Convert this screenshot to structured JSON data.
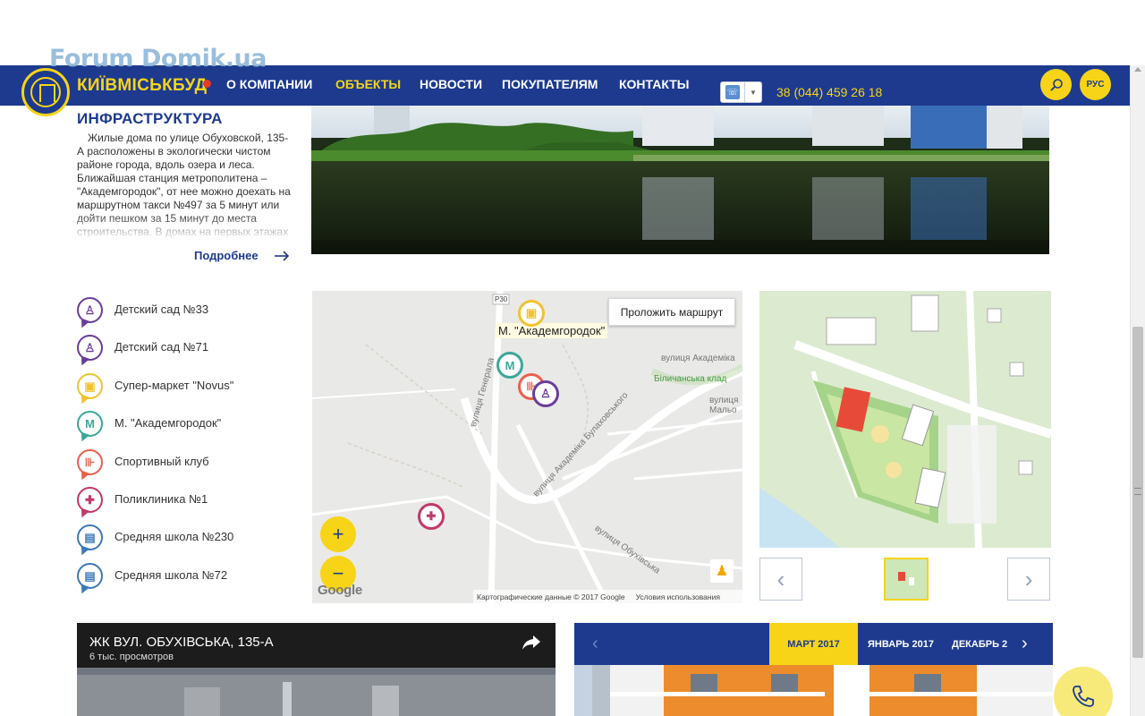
{
  "watermark": "Forum Domik.ua",
  "header": {
    "logo_text": "КИЇВМІСЬКБУД",
    "nav": [
      "О КОМПАНИИ",
      "ОБЪЕКТЫ",
      "НОВОСТИ",
      "ПОКУПАТЕЛЯМ",
      "КОНТАКТЫ"
    ],
    "active_nav": "ОБЪЕКТЫ",
    "phone": "38 (044) 459 26 18",
    "lang": "РУС",
    "search_icon": "search-icon"
  },
  "infrastructure": {
    "title": "ИНФРАСТРУКТУРА",
    "text": "Жилые дома по улице Обуховской, 135-А расположены в экологически чистом районе города, вдоль озера и леса. Ближайшая станция метрополитена – \"Академгородок\", от нее можно доехать на маршрутном такси №497 за 5 минут или дойти пешком за 15 минут до места строительства. В домах на первых этажах",
    "more": "Подробнее"
  },
  "legend": [
    {
      "label": "Детский сад №33",
      "icon": "kids-icon",
      "color": "#6a3d9a"
    },
    {
      "label": "Детский сад №71",
      "icon": "kids-icon",
      "color": "#6a3d9a"
    },
    {
      "label": "Супер-маркет \"Novus\"",
      "icon": "shopping-bag-icon",
      "color": "#f2c230"
    },
    {
      "label": "М. \"Академгородок\"",
      "icon": "metro-icon",
      "color": "#3aa89a"
    },
    {
      "label": "Спортивный клуб",
      "icon": "dumbbell-icon",
      "color": "#e8604c"
    },
    {
      "label": "Поликлиника №1",
      "icon": "medical-icon",
      "color": "#c2386a"
    },
    {
      "label": "Средняя школа №230",
      "icon": "book-icon",
      "color": "#3d79b8"
    },
    {
      "label": "Средняя школа №72",
      "icon": "book-icon",
      "color": "#3d79b8"
    }
  ],
  "map": {
    "route_button": "Проложить маршрут",
    "metro_label": "М. \"Академгородок\"",
    "road_label": "Р30",
    "streets": [
      "вулиця Академіка",
      "Біличанська клад",
      "вулиця Мальо",
      "вулиця Генерала",
      "вулиця Академіка Булаховського",
      "вулиця Обухівська"
    ],
    "zoom_in": "+",
    "zoom_out": "−",
    "google": "Google",
    "credits": "Картографические данные © 2017 Google",
    "terms": "Условия использования"
  },
  "gallery": {
    "prev": "‹",
    "next": "›"
  },
  "video": {
    "title": "ЖК ВУЛ. ОБУХІВСЬКА, 135-А",
    "views": "6 тыс. просмотров"
  },
  "timeline": {
    "months": [
      "МАРТ 2017",
      "ЯНВАРЬ 2017",
      "ДЕКАБРЬ 2"
    ],
    "active": "МАРТ 2017"
  },
  "colors": {
    "brand_blue": "#1d3a8f",
    "accent_yellow": "#f7d417"
  }
}
